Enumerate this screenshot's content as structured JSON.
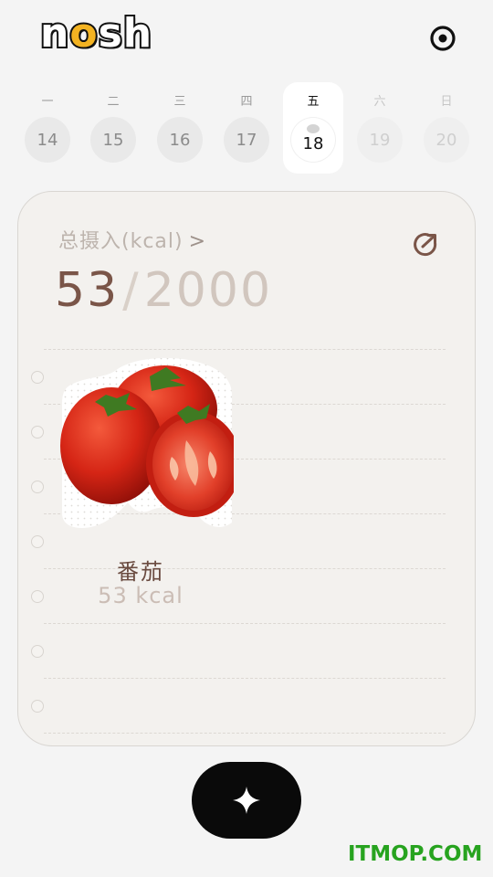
{
  "app": {
    "logo_prefix": "n",
    "logo_o": "o",
    "logo_suffix": "sh",
    "settings_icon": "settings-circle-icon"
  },
  "week": [
    {
      "dow": "一",
      "date": "14",
      "state": "past"
    },
    {
      "dow": "二",
      "date": "15",
      "state": "past"
    },
    {
      "dow": "三",
      "date": "16",
      "state": "past"
    },
    {
      "dow": "四",
      "date": "17",
      "state": "past"
    },
    {
      "dow": "五",
      "date": "18",
      "state": "selected"
    },
    {
      "dow": "六",
      "date": "19",
      "state": "future"
    },
    {
      "dow": "日",
      "date": "20",
      "state": "future"
    }
  ],
  "summary": {
    "label": "总摄入(kcal)",
    "chevron": ">",
    "consumed": "53",
    "separator": "/",
    "goal": "2000",
    "share_icon": "share-icon"
  },
  "foods": [
    {
      "name": "番茄",
      "kcal": "53 kcal",
      "image": "tomato-image"
    }
  ],
  "actions": {
    "add_icon": "sparkle-plus-icon"
  },
  "watermark": "ITMOP.COM",
  "colors": {
    "background": "#f4f4f4",
    "card": "#f3f1ee",
    "accent_brown": "#7a5548",
    "logo_yellow": "#f3b322",
    "add_button": "#0a0a0a",
    "watermark_green": "#27a31f"
  }
}
